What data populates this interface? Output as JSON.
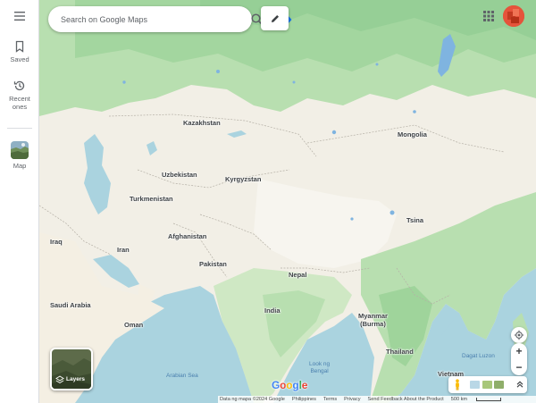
{
  "sidebar": {
    "menu_icon": "hamburger-menu-icon",
    "items": [
      {
        "label": "Saved",
        "icon": "bookmark-icon"
      },
      {
        "label": "Recent\nones",
        "icon": "history-icon"
      },
      {
        "label": "Map",
        "icon": "map-thumbnail"
      }
    ]
  },
  "search": {
    "placeholder": "Search on Google Maps",
    "value": "",
    "search_icon": "search-icon",
    "directions_icon": "directions-icon"
  },
  "edit_icon": "pencil-icon",
  "apps_icon": "apps-grid-icon",
  "map": {
    "places": [
      {
        "id": "kazakhstan",
        "name": "Kazakhstan"
      },
      {
        "id": "mongolia",
        "name": "Mongolia"
      },
      {
        "id": "uzbekistan",
        "name": "Uzbekistan"
      },
      {
        "id": "kyrgyzstan",
        "name": "Kyrgyzstan"
      },
      {
        "id": "turkmenistan",
        "name": "Turkmenistan"
      },
      {
        "id": "tsina",
        "name": "Tsina"
      },
      {
        "id": "iraq",
        "name": "Iraq"
      },
      {
        "id": "iran",
        "name": "Iran"
      },
      {
        "id": "afghanistan",
        "name": "Afghanistan"
      },
      {
        "id": "pakistan",
        "name": "Pakistan"
      },
      {
        "id": "nepal",
        "name": "Nepal"
      },
      {
        "id": "india",
        "name": "India"
      },
      {
        "id": "myanmar",
        "name": "Myanmar\n(Burma)"
      },
      {
        "id": "saudi-arabia",
        "name": "Saudi Arabia"
      },
      {
        "id": "oman",
        "name": "Oman"
      },
      {
        "id": "thailand",
        "name": "Thailand"
      },
      {
        "id": "vietnam",
        "name": "Vietnam"
      },
      {
        "id": "arabian-sea",
        "name": "Arabian Sea"
      },
      {
        "id": "look-ng-bengal",
        "name": "Look ng\nBengal"
      },
      {
        "id": "dagat-luzon",
        "name": "Dagat Luzon"
      }
    ]
  },
  "layers": {
    "label": "Layers",
    "icon": "layers-icon"
  },
  "controls": {
    "locate_icon": "my-location-icon",
    "zoom_in": "+",
    "zoom_out": "−",
    "pegman_icon": "pegman-icon",
    "expand_icon": "chevron-up-icon"
  },
  "google_logo": "Google",
  "footer": {
    "map_data": "Data ng mapa ©2024 Google",
    "country": "Philippines",
    "terms": "Terms",
    "privacy": "Privacy",
    "feedback": "Send Feedback About the Product",
    "scale": "500 km"
  },
  "colors": {
    "water": "#aad3df",
    "land": "#f2efe6",
    "green": "#b8dfb0",
    "dark_green": "#96cf96",
    "google_blue": "#4285f4",
    "google_red": "#ea4335",
    "google_yellow": "#fbbc05",
    "google_green": "#34a853"
  }
}
